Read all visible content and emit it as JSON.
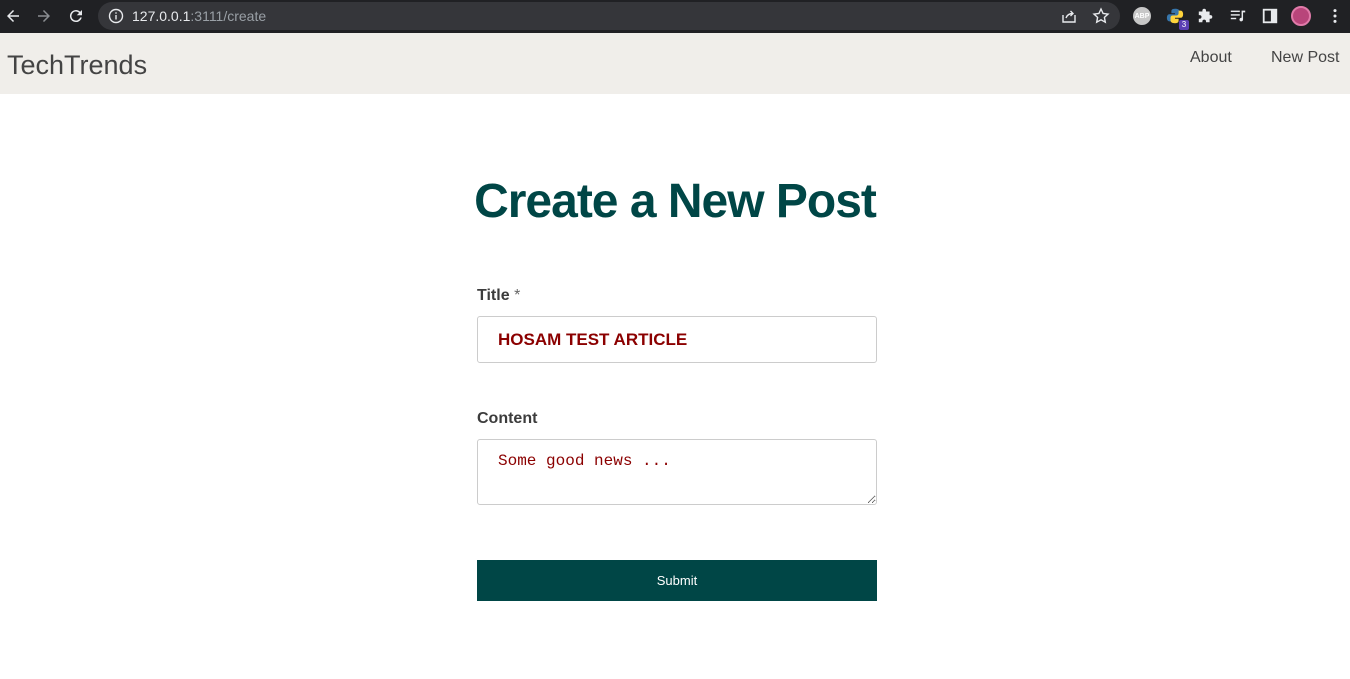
{
  "browser": {
    "url_host": "127.0.0.1",
    "url_rest": ":3111/create",
    "extension_abp_label": "ABP",
    "extension_badge_count": "3"
  },
  "navbar": {
    "brand": "TechTrends",
    "links": [
      "About",
      "New Post"
    ]
  },
  "page": {
    "title": "Create a New Post"
  },
  "form": {
    "title_label": "Title",
    "title_required_mark": "*",
    "title_value": "HOSAM TEST ARTICLE",
    "content_label": "Content",
    "content_value": "Some good news ...",
    "submit_label": "Submit"
  },
  "colors": {
    "accent": "#004646",
    "input_text": "#8b0000",
    "navbar_bg": "#f0eeea"
  }
}
